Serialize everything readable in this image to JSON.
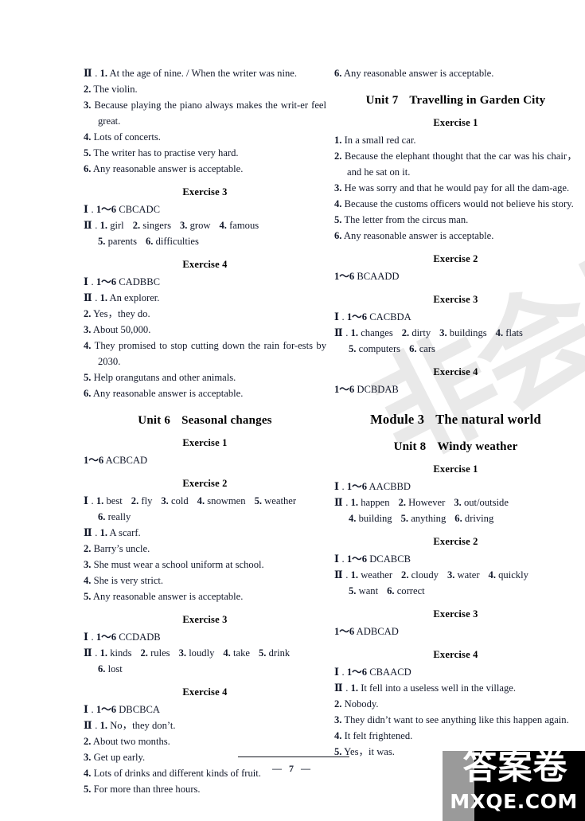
{
  "page": {
    "number": "— 7 —",
    "background_color": "#ffffff",
    "text_color": "#12182a"
  },
  "watermark": {
    "background_text": "非会员",
    "color": "#e9e9e9"
  },
  "logo": {
    "chinese": "答案卷",
    "domain": "MXQE.COM",
    "background_color": "#000000",
    "text_color": "#ffffff"
  },
  "left_column": {
    "continued_answers": {
      "roman": "Ⅱ",
      "items": [
        {
          "n": "1.",
          "text": "At the age of nine.  /  When the writer was nine."
        },
        {
          "n": "2.",
          "text": "The violin."
        },
        {
          "n": "3.",
          "text": "Because playing the piano always makes the writ-er feel great."
        },
        {
          "n": "4.",
          "text": "Lots of concerts."
        },
        {
          "n": "5.",
          "text": "The writer has to practise very hard."
        },
        {
          "n": "6.",
          "text": "Any reasonable answer is acceptable."
        }
      ]
    },
    "exercise3": {
      "heading": "Exercise 3",
      "part1_roman": "Ⅰ",
      "part1_range": "1～6",
      "part1_answers": "CBCADC",
      "part2_roman": "Ⅱ",
      "part2_line1": [
        {
          "n": "1.",
          "w": "girl"
        },
        {
          "n": "2.",
          "w": "singers"
        },
        {
          "n": "3.",
          "w": "grow"
        },
        {
          "n": "4.",
          "w": "famous"
        }
      ],
      "part2_line2": [
        {
          "n": "5.",
          "w": "parents"
        },
        {
          "n": "6.",
          "w": "difficulties"
        }
      ]
    },
    "exercise4": {
      "heading": "Exercise 4",
      "part1_roman": "Ⅰ",
      "part1_range": "1～6",
      "part1_answers": "CADBBC",
      "part2_roman": "Ⅱ",
      "items": [
        {
          "n": "1.",
          "text": "An explorer."
        },
        {
          "n": "2.",
          "text": "Yes，they do."
        },
        {
          "n": "3.",
          "text": "About 50,000."
        },
        {
          "n": "4.",
          "text": "They promised to stop cutting down the rain for-ests by 2030."
        },
        {
          "n": "5.",
          "text": "Help orangutans and other animals."
        },
        {
          "n": "6.",
          "text": "Any reasonable answer is acceptable."
        }
      ]
    },
    "unit6": {
      "label": "Unit 6",
      "title": "Seasonal changes"
    },
    "u6_exercise1": {
      "heading": "Exercise 1",
      "range": "1～6",
      "answers": "ACBCAD"
    },
    "u6_exercise2": {
      "heading": "Exercise 2",
      "part1_roman": "Ⅰ",
      "part1_line1": [
        {
          "n": "1.",
          "w": "best"
        },
        {
          "n": "2.",
          "w": "fly"
        },
        {
          "n": "3.",
          "w": "cold"
        },
        {
          "n": "4.",
          "w": "snowmen"
        },
        {
          "n": "5.",
          "w": "weather"
        }
      ],
      "part1_line2": [
        {
          "n": "6.",
          "w": "really"
        }
      ],
      "part2_roman": "Ⅱ",
      "items": [
        {
          "n": "1.",
          "text": "A scarf."
        },
        {
          "n": "2.",
          "text": "Barry’s uncle."
        },
        {
          "n": "3.",
          "text": "She must wear a school uniform at school."
        },
        {
          "n": "4.",
          "text": "She is very strict."
        },
        {
          "n": "5.",
          "text": "Any reasonable answer is acceptable."
        }
      ]
    },
    "u6_exercise3": {
      "heading": "Exercise 3",
      "part1_roman": "Ⅰ",
      "part1_range": "1～6",
      "part1_answers": "CCDADB",
      "part2_roman": "Ⅱ",
      "part2_line1": [
        {
          "n": "1.",
          "w": "kinds"
        },
        {
          "n": "2.",
          "w": "rules"
        },
        {
          "n": "3.",
          "w": "loudly"
        },
        {
          "n": "4.",
          "w": "take"
        },
        {
          "n": "5.",
          "w": "drink"
        }
      ],
      "part2_line2": [
        {
          "n": "6.",
          "w": "lost"
        }
      ]
    },
    "u6_exercise4": {
      "heading": "Exercise 4",
      "part1_roman": "Ⅰ",
      "part1_range": "1～6",
      "part1_answers": "DBCBCA",
      "part2_roman": "Ⅱ",
      "items": [
        {
          "n": "1.",
          "text": "No，they don’t."
        },
        {
          "n": "2.",
          "text": "About two months."
        },
        {
          "n": "3.",
          "text": "Get up early."
        },
        {
          "n": "4.",
          "text": "Lots of drinks and different kinds of fruit."
        },
        {
          "n": "5.",
          "text": "For more than three hours."
        }
      ]
    }
  },
  "right_column": {
    "continued_item": {
      "n": "6.",
      "text": "Any reasonable answer is acceptable."
    },
    "unit7": {
      "label": "Unit 7",
      "title": "Travelling in Garden City"
    },
    "u7_exercise1": {
      "heading": "Exercise 1",
      "items": [
        {
          "n": "1.",
          "text": "In a small red car."
        },
        {
          "n": "2.",
          "text": "Because the elephant thought that the car was his chair，and he sat on it."
        },
        {
          "n": "3.",
          "text": "He was sorry and that he would pay for all the dam-age."
        },
        {
          "n": "4.",
          "text": "Because the customs officers would not believe his story."
        },
        {
          "n": "5.",
          "text": "The letter from the circus man."
        },
        {
          "n": "6.",
          "text": "Any reasonable answer is acceptable."
        }
      ]
    },
    "u7_exercise2": {
      "heading": "Exercise 2",
      "range": "1～6",
      "answers": "BCAADD"
    },
    "u7_exercise3": {
      "heading": "Exercise 3",
      "part1_roman": "Ⅰ",
      "part1_range": "1～6",
      "part1_answers": "CACBDA",
      "part2_roman": "Ⅱ",
      "part2_line1": [
        {
          "n": "1.",
          "w": "changes"
        },
        {
          "n": "2.",
          "w": "dirty"
        },
        {
          "n": "3.",
          "w": "buildings"
        },
        {
          "n": "4.",
          "w": "flats"
        }
      ],
      "part2_line2": [
        {
          "n": "5.",
          "w": "computers"
        },
        {
          "n": "6.",
          "w": "cars"
        }
      ]
    },
    "u7_exercise4": {
      "heading": "Exercise 4",
      "range": "1～6",
      "answers": "DCBDAB"
    },
    "module3": {
      "label": "Module 3",
      "title": "The natural world"
    },
    "unit8": {
      "label": "Unit 8",
      "title": "Windy weather"
    },
    "u8_exercise1": {
      "heading": "Exercise 1",
      "part1_roman": "Ⅰ",
      "part1_range": "1～6",
      "part1_answers": "AACBBD",
      "part2_roman": "Ⅱ",
      "part2_line1": [
        {
          "n": "1.",
          "w": "happen"
        },
        {
          "n": "2.",
          "w": "However"
        },
        {
          "n": "3.",
          "w": "out/outside"
        }
      ],
      "part2_line2": [
        {
          "n": "4.",
          "w": "building"
        },
        {
          "n": "5.",
          "w": "anything"
        },
        {
          "n": "6.",
          "w": "driving"
        }
      ]
    },
    "u8_exercise2": {
      "heading": "Exercise 2",
      "part1_roman": "Ⅰ",
      "part1_range": "1～6",
      "part1_answers": "DCABCB",
      "part2_roman": "Ⅱ",
      "part2_line1": [
        {
          "n": "1.",
          "w": "weather"
        },
        {
          "n": "2.",
          "w": "cloudy"
        },
        {
          "n": "3.",
          "w": "water"
        },
        {
          "n": "4.",
          "w": "quickly"
        }
      ],
      "part2_line2": [
        {
          "n": "5.",
          "w": "want"
        },
        {
          "n": "6.",
          "w": "correct"
        }
      ]
    },
    "u8_exercise3": {
      "heading": "Exercise 3",
      "range": "1～6",
      "answers": "ADBCAD"
    },
    "u8_exercise4": {
      "heading": "Exercise 4",
      "part1_roman": "Ⅰ",
      "part1_range": "1～6",
      "part1_answers": "CBAACD",
      "part2_roman": "Ⅱ",
      "items": [
        {
          "n": "1.",
          "text": "It fell into a useless well in the village."
        },
        {
          "n": "2.",
          "text": "Nobody."
        },
        {
          "n": "3.",
          "text": "They didn’t want to see anything like this happen again."
        },
        {
          "n": "4.",
          "text": "It felt frightened."
        },
        {
          "n": "5.",
          "text": "Yes，it was."
        }
      ]
    }
  }
}
